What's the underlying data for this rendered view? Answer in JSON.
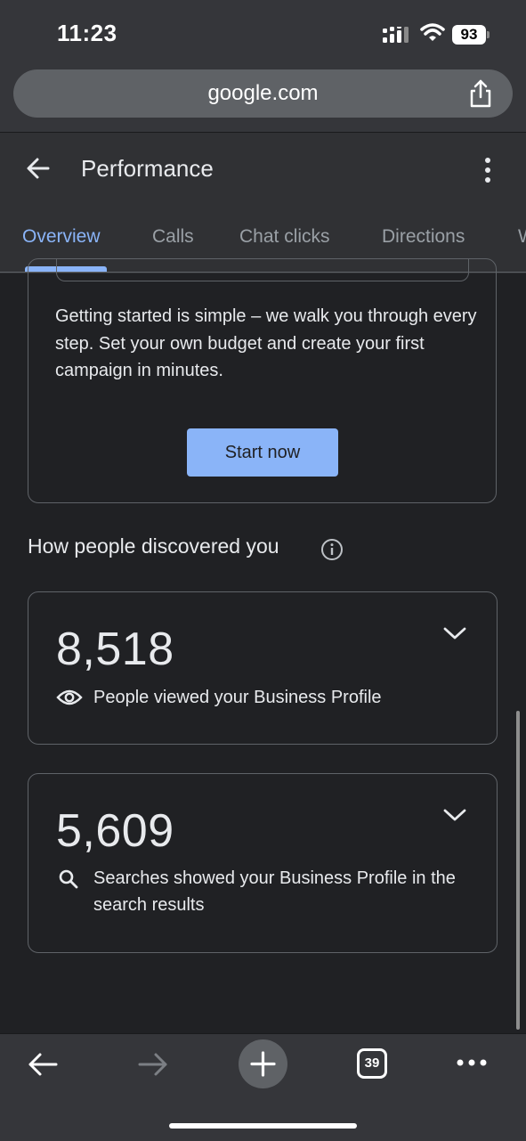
{
  "status_bar": {
    "time": "11:23",
    "battery": "93"
  },
  "browser": {
    "url": "google.com",
    "tab_count": "39"
  },
  "header": {
    "title": "Performance"
  },
  "tabs": [
    {
      "label": "Overview",
      "active": true
    },
    {
      "label": "Calls"
    },
    {
      "label": "Chat clicks"
    },
    {
      "label": "Directions"
    },
    {
      "label": "W"
    }
  ],
  "promo": {
    "text": "Getting started is simple – we walk you through every step. Set your own budget and create your first campaign in minutes.",
    "button": "Start now"
  },
  "discovery": {
    "title": "How people discovered you",
    "cards": [
      {
        "value": "8,518",
        "description": "People viewed your Business Profile",
        "icon": "eye-icon"
      },
      {
        "value": "5,609",
        "description": "Searches showed your Business Profile in the search results",
        "icon": "search-icon"
      }
    ]
  },
  "colors": {
    "accent": "#8ab4f8",
    "background": "#202124",
    "header": "#303134",
    "chrome": "#35363a"
  }
}
